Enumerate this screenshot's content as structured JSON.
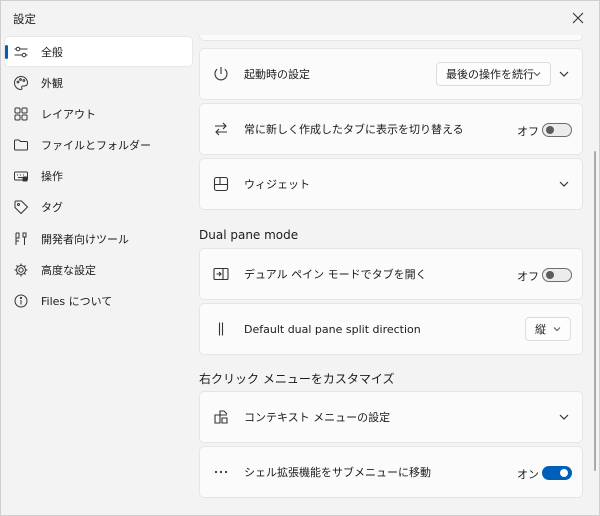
{
  "window": {
    "title": "設定"
  },
  "sidebar": {
    "items": [
      {
        "label": "全般",
        "icon": "sliders-icon",
        "active": true
      },
      {
        "label": "外観",
        "icon": "palette-icon",
        "active": false
      },
      {
        "label": "レイアウト",
        "icon": "grid-icon",
        "active": false
      },
      {
        "label": "ファイルとフォルダー",
        "icon": "folder-icon",
        "active": false
      },
      {
        "label": "操作",
        "icon": "keyboard-icon",
        "active": false
      },
      {
        "label": "タグ",
        "icon": "tag-icon",
        "active": false
      },
      {
        "label": "開発者向けツール",
        "icon": "tools-icon",
        "active": false
      },
      {
        "label": "高度な設定",
        "icon": "advanced-icon",
        "active": false
      },
      {
        "label": "Files について",
        "icon": "info-icon",
        "active": false
      }
    ]
  },
  "main": {
    "startup": {
      "label": "起動時の設定",
      "dropdown_value": "最後の操作を続行"
    },
    "new_tab_switch": {
      "label": "常に新しく作成したタブに表示を切り替える",
      "state_label": "オフ",
      "enabled": false
    },
    "widgets": {
      "label": "ウィジェット"
    },
    "dual_pane": {
      "header": "Dual pane mode",
      "open_tabs": {
        "label": "デュアル ペイン モードでタブを開く",
        "state_label": "オフ",
        "enabled": false
      },
      "split_direction": {
        "label": "Default dual pane split direction",
        "dropdown_value": "縦"
      }
    },
    "context_menu": {
      "header": "右クリック メニューをカスタマイズ",
      "settings": {
        "label": "コンテキスト メニューの設定"
      },
      "move_shell_ext": {
        "label": "シェル拡張機能をサブメニューに移動",
        "state_label": "オン",
        "enabled": true
      }
    }
  },
  "colors": {
    "accent": "#005fb8",
    "background": "#f3f3f3",
    "card": "#fbfbfb"
  }
}
